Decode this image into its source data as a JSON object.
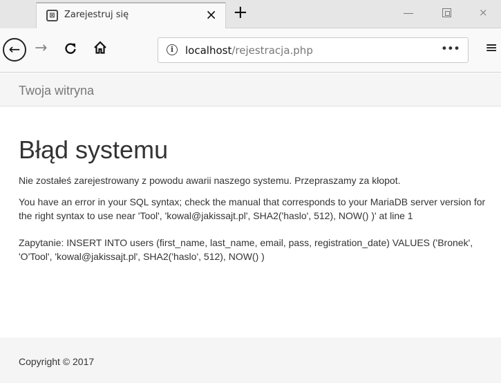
{
  "browser": {
    "tab_title": "Zarejestruj się",
    "tab_close": "×",
    "new_tab": "+",
    "window_close": "⨯",
    "favicon": "⊠",
    "url_host": "localhost",
    "url_path": "/rejestracja.php",
    "url_more": "•••",
    "back": "←",
    "forward": "→",
    "reload": "C",
    "home": "⌂",
    "info": "i",
    "menu": "≡"
  },
  "site": {
    "brand": "Twoja witryna"
  },
  "main": {
    "title": "Błąd systemu",
    "message": "Nie zostałeś zarejestrowany z powodu awarii naszego systemu. Przepraszamy za kłopot.",
    "error": "You have an error in your SQL syntax; check the manual that corresponds to your MariaDB server version for the right syntax to use near 'Tool', 'kowal@jakissajt.pl', SHA2('haslo', 512), NOW() )' at line 1",
    "query": "Zapytanie: INSERT INTO users (first_name, last_name, email, pass, registration_date) VALUES ('Bronek', 'O'Tool', 'kowal@jakissajt.pl', SHA2('haslo', 512), NOW() )"
  },
  "footer": {
    "copyright": "Copyright © 2017"
  }
}
